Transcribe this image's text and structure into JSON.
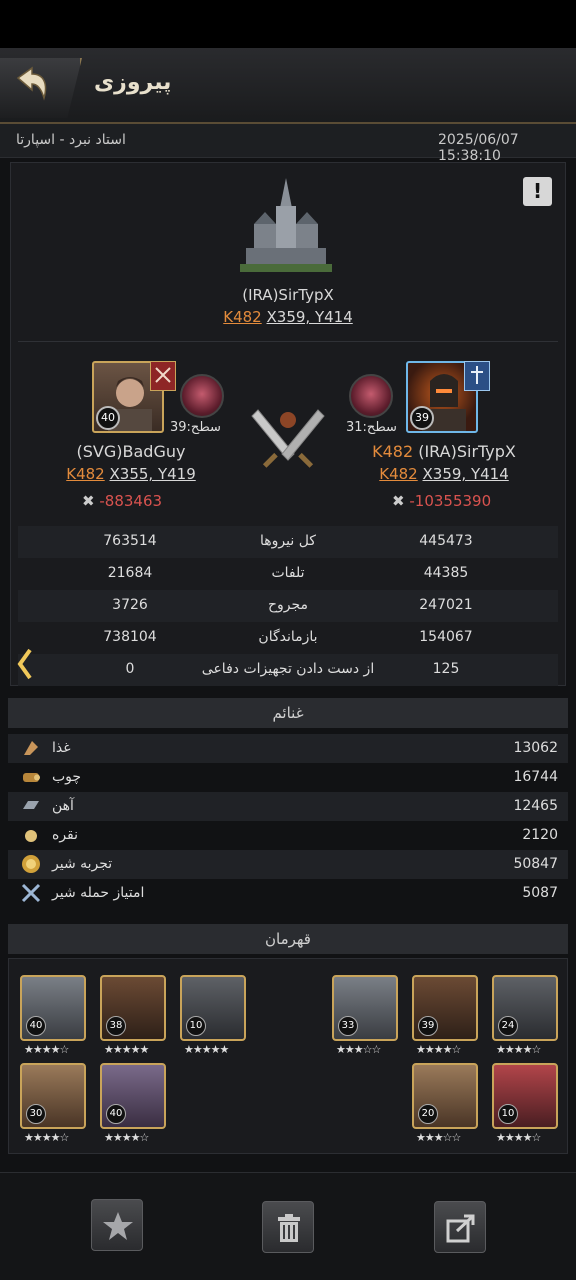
{
  "header": {
    "title": "پیروزی"
  },
  "report": {
    "datetime": "2025/06/07 15:38:10",
    "location": "استاد نبرد - اسپارتا"
  },
  "target": {
    "name": "(IRA)SirTypX",
    "kingdom": "K482",
    "coords": "X359, Y414"
  },
  "left_player": {
    "name": "(SVG)BadGuy",
    "kingdom": "K482",
    "coords": "X355, Y419",
    "level": "40",
    "dragon_level": "سطح:39",
    "power_change": "-883463"
  },
  "right_player": {
    "name_kingdom": "K482",
    "name": "(IRA)SirTypX",
    "kingdom": "K482",
    "coords": "X359, Y414",
    "level": "39",
    "dragon_level": "سطح:31",
    "power_change": "-10355390"
  },
  "stats": [
    {
      "label": "کل نیروها",
      "left": "763514",
      "right": "445473"
    },
    {
      "label": "تلفات",
      "left": "21684",
      "right": "44385"
    },
    {
      "label": "مجروح",
      "left": "3726",
      "right": "247021"
    },
    {
      "label": "بازماندگان",
      "left": "738104",
      "right": "154067"
    },
    {
      "label": "از دست دادن تجهیزات دفاعی",
      "left": "0",
      "right": "125"
    }
  ],
  "loot": {
    "title": "غنائم",
    "items": [
      {
        "name": "غذا",
        "value": "13062",
        "icon": "food-icon"
      },
      {
        "name": "چوب",
        "value": "16744",
        "icon": "wood-icon"
      },
      {
        "name": "آهن",
        "value": "12465",
        "icon": "iron-icon"
      },
      {
        "name": "نقره",
        "value": "2120",
        "icon": "silver-icon"
      },
      {
        "name": "تجربه شیر",
        "value": "50847",
        "icon": "lion-xp-icon"
      },
      {
        "name": "امتیاز حمله شیر",
        "value": "5087",
        "icon": "lion-attack-icon"
      }
    ]
  },
  "heroes": {
    "title": "قهرمان",
    "left": [
      {
        "level": "40",
        "stars": "★★★★☆"
      },
      {
        "level": "38",
        "stars": "★★★★★"
      },
      {
        "level": "10",
        "stars": "★★★★★"
      },
      {
        "level": "30",
        "stars": "★★★★☆"
      },
      {
        "level": "40",
        "stars": "★★★★☆"
      }
    ],
    "right": [
      {
        "level": "33",
        "stars": "★★★☆☆"
      },
      {
        "level": "39",
        "stars": "★★★★☆"
      },
      {
        "level": "24",
        "stars": "★★★★☆"
      },
      {
        "level": "20",
        "stars": "★★★☆☆"
      },
      {
        "level": "10",
        "stars": "★★★★☆"
      }
    ]
  },
  "footer": {
    "favorite": "star-icon",
    "delete": "trash-icon",
    "share": "share-icon"
  }
}
